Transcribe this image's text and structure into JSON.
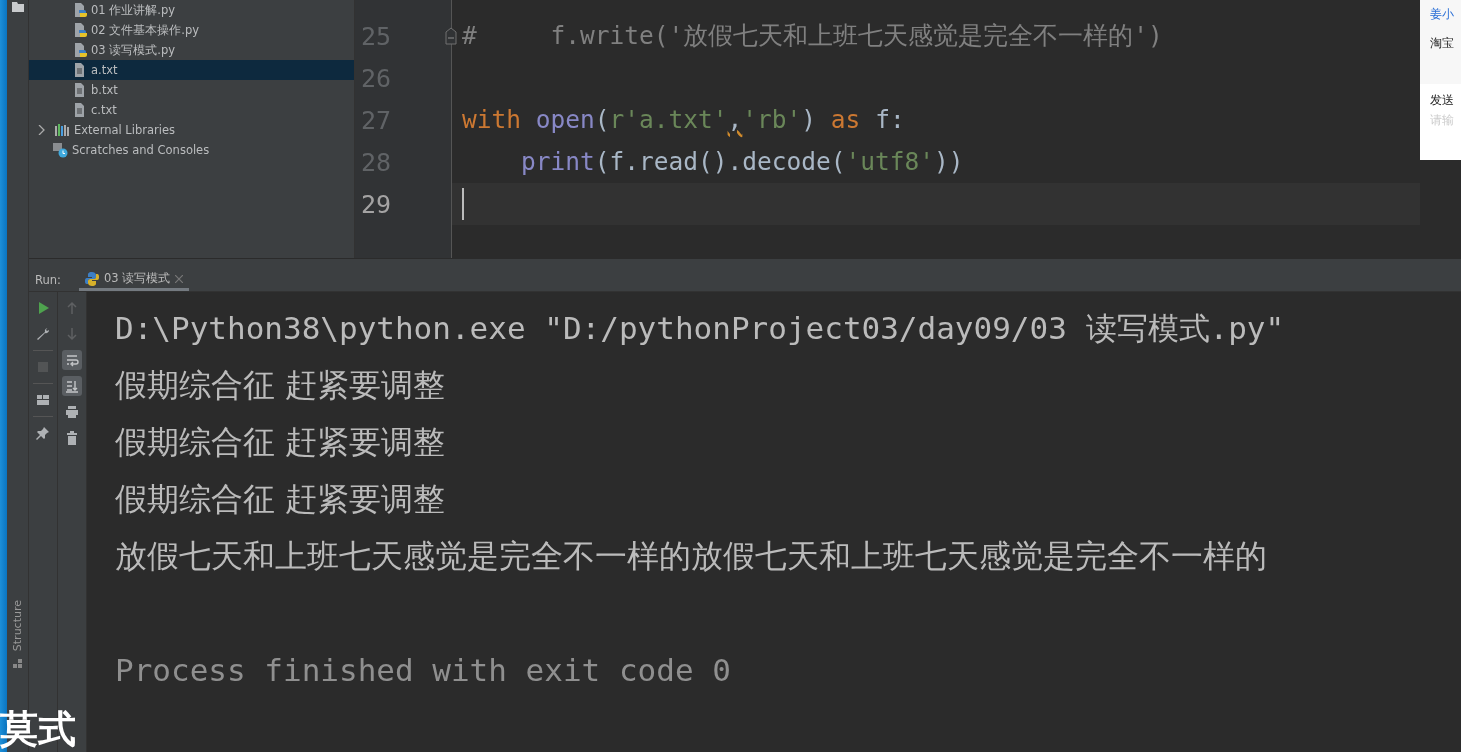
{
  "project_tree": {
    "items": [
      {
        "label": "01 作业讲解.py",
        "kind": "python",
        "selected": false
      },
      {
        "label": "02 文件基本操作.py",
        "kind": "python",
        "selected": false
      },
      {
        "label": "03 读写模式.py",
        "kind": "python",
        "selected": false
      },
      {
        "label": "a.txt",
        "kind": "text",
        "selected": true
      },
      {
        "label": "b.txt",
        "kind": "text",
        "selected": false
      },
      {
        "label": "c.txt",
        "kind": "text",
        "selected": false
      }
    ],
    "libraries": {
      "label": "External Libraries",
      "expanded": false
    },
    "scratches": {
      "label": "Scratches and Consoles"
    }
  },
  "editor": {
    "lines": [
      {
        "number": "25",
        "current": false,
        "folded": false,
        "tokens": [
          {
            "text": "#     f.write('放假七天和上班七天感觉是完全不一样的')",
            "kind": "comment"
          }
        ]
      },
      {
        "number": "26",
        "current": false
      },
      {
        "number": "27",
        "current": false,
        "tokens": [
          {
            "text": "with ",
            "kind": "keyword"
          },
          {
            "text": "open",
            "kind": "builtin"
          },
          {
            "text": "(",
            "kind": "plain"
          },
          {
            "text": "r'a.txt'",
            "kind": "string"
          },
          {
            "text": ",",
            "kind": "warning"
          },
          {
            "text": "'rb'",
            "kind": "string"
          },
          {
            "text": ") ",
            "kind": "plain"
          },
          {
            "text": "as",
            "kind": "keyword"
          },
          {
            "text": " f:",
            "kind": "plain"
          }
        ]
      },
      {
        "number": "28",
        "current": false,
        "tokens": [
          {
            "text": "    print",
            "kind": "builtin"
          },
          {
            "text": "(f.read().decode(",
            "kind": "plain"
          },
          {
            "text": "'utf8'",
            "kind": "string"
          },
          {
            "text": "))",
            "kind": "plain"
          }
        ]
      },
      {
        "number": "29",
        "current": true
      }
    ]
  },
  "popup": {
    "sender": "姜小",
    "message": "淘宝",
    "send_label": "发送",
    "placeholder": "请输"
  },
  "run_panel": {
    "label": "Run:",
    "tab": {
      "label": "03 读写模式"
    },
    "tools": [
      {
        "kind": "run",
        "disabled": false
      },
      {
        "kind": "wrench",
        "disabled": false
      },
      {
        "kind": "stop",
        "disabled": true
      },
      {
        "kind": "layout",
        "disabled": false
      },
      {
        "kind": "pin",
        "disabled": false
      }
    ],
    "tools_right": [
      {
        "kind": "up",
        "on": false
      },
      {
        "kind": "down",
        "on": false
      },
      {
        "kind": "wrap",
        "on": true
      },
      {
        "kind": "scroll-end",
        "on": true
      },
      {
        "kind": "print",
        "on": false
      },
      {
        "kind": "trash",
        "on": false
      }
    ],
    "side_label": "Structure",
    "console": [
      {
        "text": "D:\\Python38\\python.exe \"D:/pythonProject03/day09/03 读写模式.py\"",
        "kind": "command"
      },
      {
        "text": "假期综合征 赶紧要调整",
        "kind": "output"
      },
      {
        "text": "假期综合征 赶紧要调整",
        "kind": "output"
      },
      {
        "text": "假期综合征 赶紧要调整",
        "kind": "output"
      },
      {
        "text": "放假七天和上班七天感觉是完全不一样的放假七天和上班七天感觉是完全不一样的",
        "kind": "output"
      },
      {
        "text": "Process finished with exit code 0",
        "kind": "exit"
      }
    ]
  },
  "subtitle": "莫式"
}
